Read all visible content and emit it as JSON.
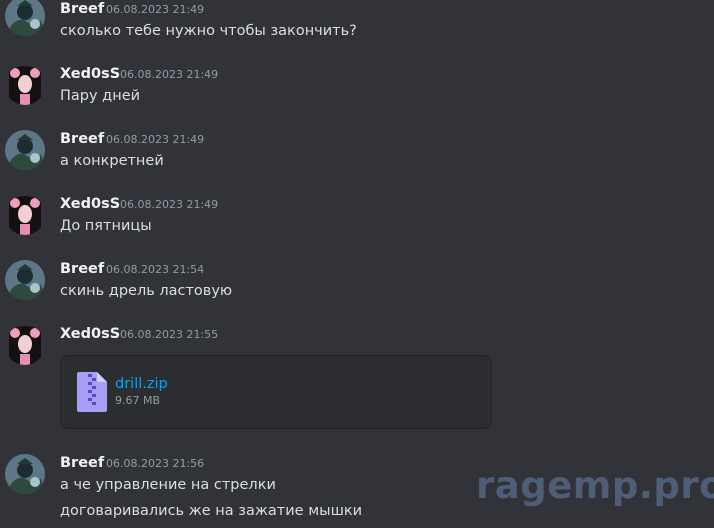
{
  "messages": [
    {
      "author": "Breef",
      "timestamp": "06.08.2023 21:49",
      "lines": [
        "сколько тебе нужно чтобы закончить?"
      ]
    },
    {
      "author": "Xed0sS",
      "timestamp": "06.08.2023 21:49",
      "lines": [
        "Пару дней"
      ]
    },
    {
      "author": "Breef",
      "timestamp": "06.08.2023 21:49",
      "lines": [
        "а конкретней"
      ]
    },
    {
      "author": "Xed0sS",
      "timestamp": "06.08.2023 21:49",
      "lines": [
        "До пятницы"
      ]
    },
    {
      "author": "Breef",
      "timestamp": "06.08.2023 21:54",
      "lines": [
        "скинь дрель ластовую"
      ]
    },
    {
      "author": "Xed0sS",
      "timestamp": "06.08.2023 21:55",
      "attachment": {
        "name": "drill.zip",
        "size": "9.67 MB"
      }
    },
    {
      "author": "Breef",
      "timestamp": "06.08.2023 21:56",
      "lines": [
        "а че управление на стрелки",
        "договаривались же на зажатие мышки"
      ]
    }
  ],
  "watermark": "ragemp.pro",
  "colors": {
    "background": "#313338",
    "link": "#00a8fc",
    "zip_icon": "#a79ef7"
  }
}
